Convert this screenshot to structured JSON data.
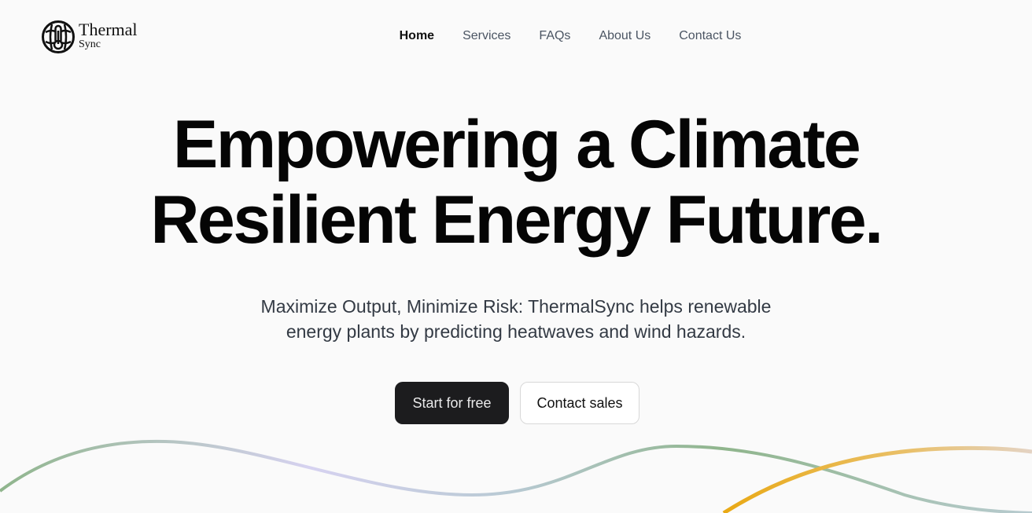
{
  "brand": {
    "name_line1": "Thermal",
    "name_line2": "Sync",
    "logo_icon": "globe-thermometer-icon"
  },
  "nav": {
    "items": [
      {
        "label": "Home",
        "active": true
      },
      {
        "label": "Services",
        "active": false
      },
      {
        "label": "FAQs",
        "active": false
      },
      {
        "label": "About Us",
        "active": false
      },
      {
        "label": "Contact Us",
        "active": false
      }
    ]
  },
  "hero": {
    "title_line1": "Empowering a Climate",
    "title_line2": "Resilient Energy Future.",
    "subtitle_line1": "Maximize Output, Minimize Risk: ThermalSync helps renewable",
    "subtitle_line2": "energy plants by predicting heatwaves and wind hazards."
  },
  "actions": {
    "primary_label": "Start for free",
    "secondary_label": "Contact sales"
  },
  "colors": {
    "background": "#fafafa",
    "primary_button": "#1c1c1e",
    "wave_green": "#8fb58c",
    "wave_lavender": "#d6d2f0",
    "wave_yellow": "#e9b12f"
  }
}
